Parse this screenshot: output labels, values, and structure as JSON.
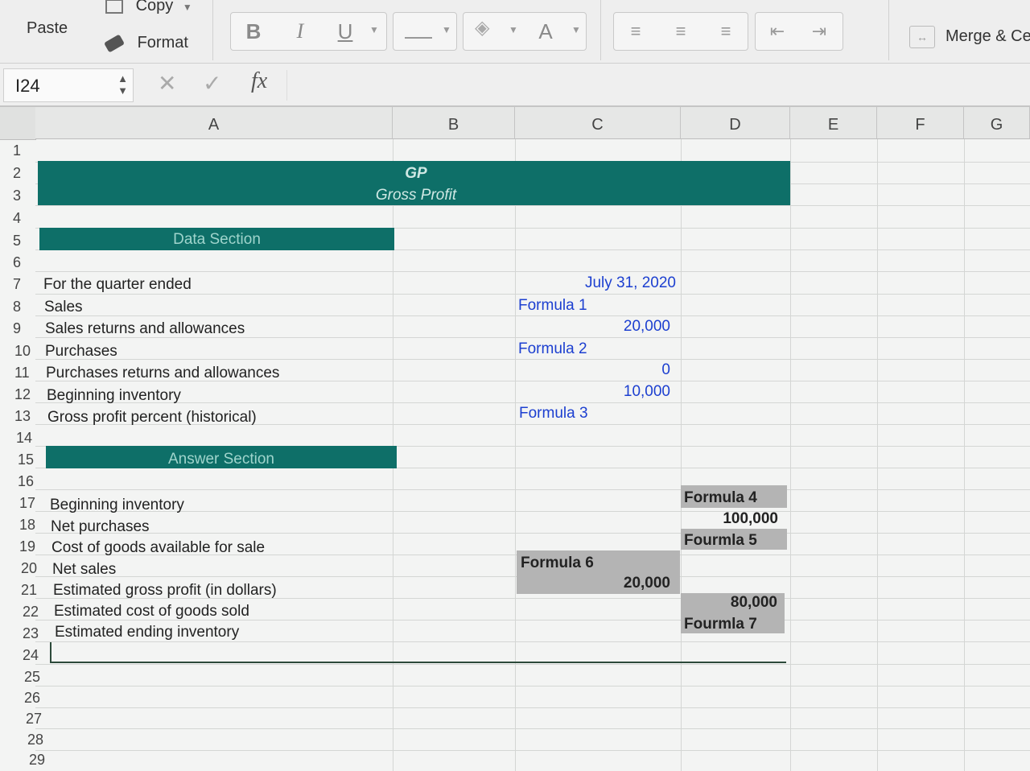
{
  "ribbon": {
    "paste_label": "Paste",
    "copy_label": "Copy",
    "format_label": "Format",
    "bold_label": "B",
    "italic_label": "I",
    "underline_label": "U",
    "font_color_label": "A",
    "merge_label": "Merge & Ce"
  },
  "formula_bar": {
    "cell_ref": "I24",
    "fx_label": "fx",
    "content": ""
  },
  "columns": [
    "A",
    "B",
    "C",
    "D",
    "E",
    "F",
    "G"
  ],
  "rows": [
    "1",
    "2",
    "3",
    "4",
    "5",
    "6",
    "7",
    "8",
    "9",
    "10",
    "11",
    "12",
    "13",
    "14",
    "15",
    "16",
    "17",
    "18",
    "19",
    "20",
    "21",
    "22",
    "23",
    "24",
    "25",
    "26",
    "27",
    "28",
    "29"
  ],
  "sheet": {
    "header_line1": "GP",
    "header_line2": "Gross Profit",
    "data_section": "Data Section",
    "answer_section": "Answer Section",
    "row7_label": "For the quarter ended",
    "row7_value": "July 31, 2020",
    "row8_label": "Sales",
    "row8_value": "Formula 1",
    "row9_label": "Sales returns and allowances",
    "row9_value": "20,000",
    "row10_label": "Purchases",
    "row10_value": "Formula 2",
    "row11_label": "Purchases returns and allowances",
    "row11_value": "0",
    "row12_label": "Beginning inventory",
    "row12_value": "10,000",
    "row13_label": "Gross profit percent (historical)",
    "row13_value": "Formula 3",
    "row17_label": "Beginning inventory",
    "row17_d": "Formula 4",
    "row18_label": "Net purchases",
    "row18_d": "100,000",
    "row19_label": "Cost of goods available for sale",
    "row19_d": "Fourmla 5",
    "row20_label": "Net sales",
    "row20_c": "Formula 6",
    "row21_label": "Estimated gross profit (in dollars)",
    "row21_c": "20,000",
    "row22_label": "Estimated cost of goods sold",
    "row22_d": "80,000",
    "row23_label": "Estimated ending inventory",
    "row23_d": "Fourmla 7"
  },
  "colors": {
    "band": "#0e6f68",
    "link_blue": "#1c3fd0",
    "answer_gray": "#b4b4b4"
  }
}
